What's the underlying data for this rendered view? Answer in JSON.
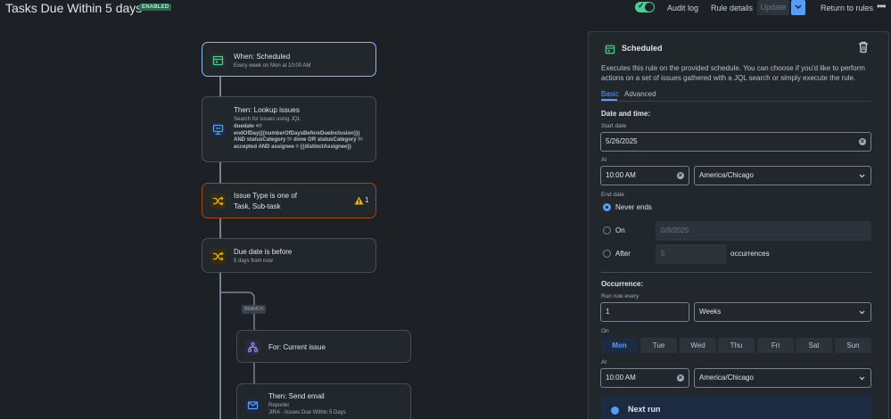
{
  "header": {
    "title": "Tasks Due Within 5 days",
    "status_badge": "ENABLED",
    "audit_log": "Audit log",
    "rule_details": "Rule details",
    "update": "Update",
    "return": "Return to rules",
    "more": "•••"
  },
  "nodes": {
    "trigger": {
      "title": "When: Scheduled",
      "subtitle": "Every week on Mon at 10:00 AM"
    },
    "lookup": {
      "title": "Then: Lookup issues",
      "subtitle": "Search for issues using JQL",
      "jql": [
        "duedate <=",
        "endOfDay({{numberOfDaysBeforeDueInclusion}})",
        "AND statusCategory != done OR statusCategory !=",
        "accepted AND assignee = {{distinctAssignee}}"
      ]
    },
    "issue_type": {
      "title": "Issue Type is one of",
      "subtitle": "Task, Sub-task",
      "warning_count": "1"
    },
    "due_date": {
      "title": "Due date is before",
      "subtitle": "5 days from now"
    },
    "branch_label": "BRANCH",
    "for_issue": {
      "title": "For: Current issue"
    },
    "send_email": {
      "title": "Then: Send email",
      "line1": "Reporter",
      "line2": "JIRA - Issues Due Within 5 Days"
    }
  },
  "panel": {
    "title": "Scheduled",
    "description": "Executes this rule on the provided schedule. You can choose if you'd like to perform actions on a set of issues gathered with a JQL search or simply execute the rule.",
    "tabs": [
      "Basic",
      "Advanced"
    ],
    "date_time_heading": "Date and time:",
    "start_date_label": "Start date",
    "start_date": "5/26/2025",
    "at_label": "At",
    "time": "10:00 AM",
    "timezone": "America/Chicago",
    "end_date_label": "End date",
    "never_ends": "Never ends",
    "on_label": "On",
    "on_date_placeholder": "0/9/2025",
    "after_label": "After",
    "after_placeholder": "5",
    "occurrences": "occurrences",
    "occurrence_heading": "Occurrence:",
    "run_every_label": "Run rule every",
    "run_every": "1",
    "period": "Weeks",
    "on_days_label": "On",
    "days": [
      "Mon",
      "Tue",
      "Wed",
      "Thu",
      "Fri",
      "Sat",
      "Sun"
    ],
    "selected_day": "Mon",
    "at_label2": "At",
    "time2": "10:00 AM",
    "timezone2": "America/Chicago",
    "next_run": "Next run"
  },
  "colors": {
    "background": "#1d2125",
    "accent": "#579dff",
    "enabled_green": "#4bce97",
    "warning": "#e2b203",
    "selected_node_border": "#85b8ff",
    "warning_node_border": "#a54800"
  },
  "icons": [
    "calendar-icon",
    "lookup-icon",
    "shuffle-icon",
    "branch-icon",
    "mail-icon",
    "trash-icon",
    "warning-icon",
    "chevron-down-icon",
    "clear-icon",
    "info-icon"
  ]
}
